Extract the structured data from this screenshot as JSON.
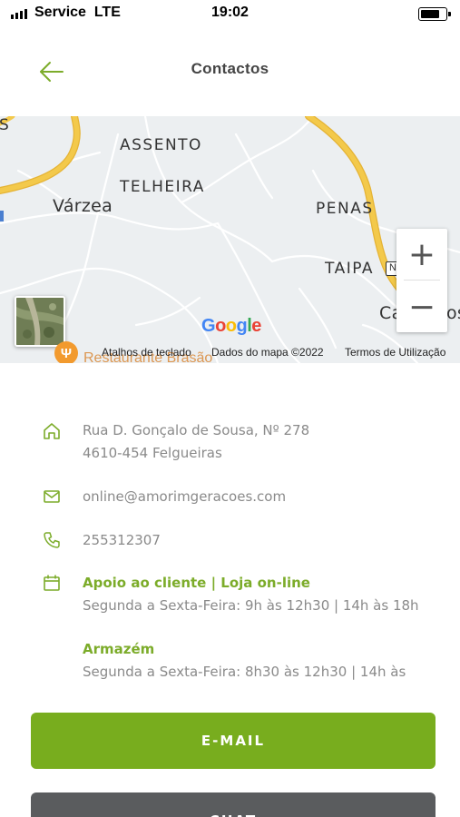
{
  "status_bar": {
    "carrier": "Service",
    "network": "LTE",
    "time": "19:02"
  },
  "header": {
    "title": "Contactos"
  },
  "map": {
    "places": {
      "s_edge": "S",
      "assento": "ASSENTO",
      "telheira": "TELHEIRA",
      "varzea": "Várzea",
      "penas": "PENAS",
      "taipa": "TAIPA",
      "ca_edge": "Ca",
      "os_edge": "os"
    },
    "road_badge": "N",
    "poi": "Restaurante Brasão",
    "zoom_in": "+",
    "zoom_out": "−",
    "footer": {
      "shortcuts": "Atalhos de teclado",
      "data": "Dados do mapa ©2022",
      "terms": "Termos de Utilização"
    },
    "colors": {
      "road": "#f3c94b",
      "road_border": "#e5b335",
      "minor": "#ffffff",
      "background": "#eceff1"
    }
  },
  "contact": {
    "address_line1": "Rua D. Gonçalo de Sousa, Nº 278",
    "address_line2": "4610-454 Felgueiras",
    "email": "online@amorimgeracoes.com",
    "phone": "255312307",
    "support_title": "Apoio ao cliente | Loja on-line",
    "support_hours": "Segunda a Sexta-Feira: 9h às 12h30 | 14h às 18h",
    "warehouse_title": "Armazém",
    "warehouse_hours": "Segunda a Sexta-Feira: 8h30 às 12h30 | 14h às"
  },
  "buttons": {
    "email": "E-MAIL",
    "chat": "CHAT"
  },
  "colors": {
    "accent": "#7cac2a",
    "email_button": "#78ad1e",
    "chat_button": "#5a5c5e"
  }
}
